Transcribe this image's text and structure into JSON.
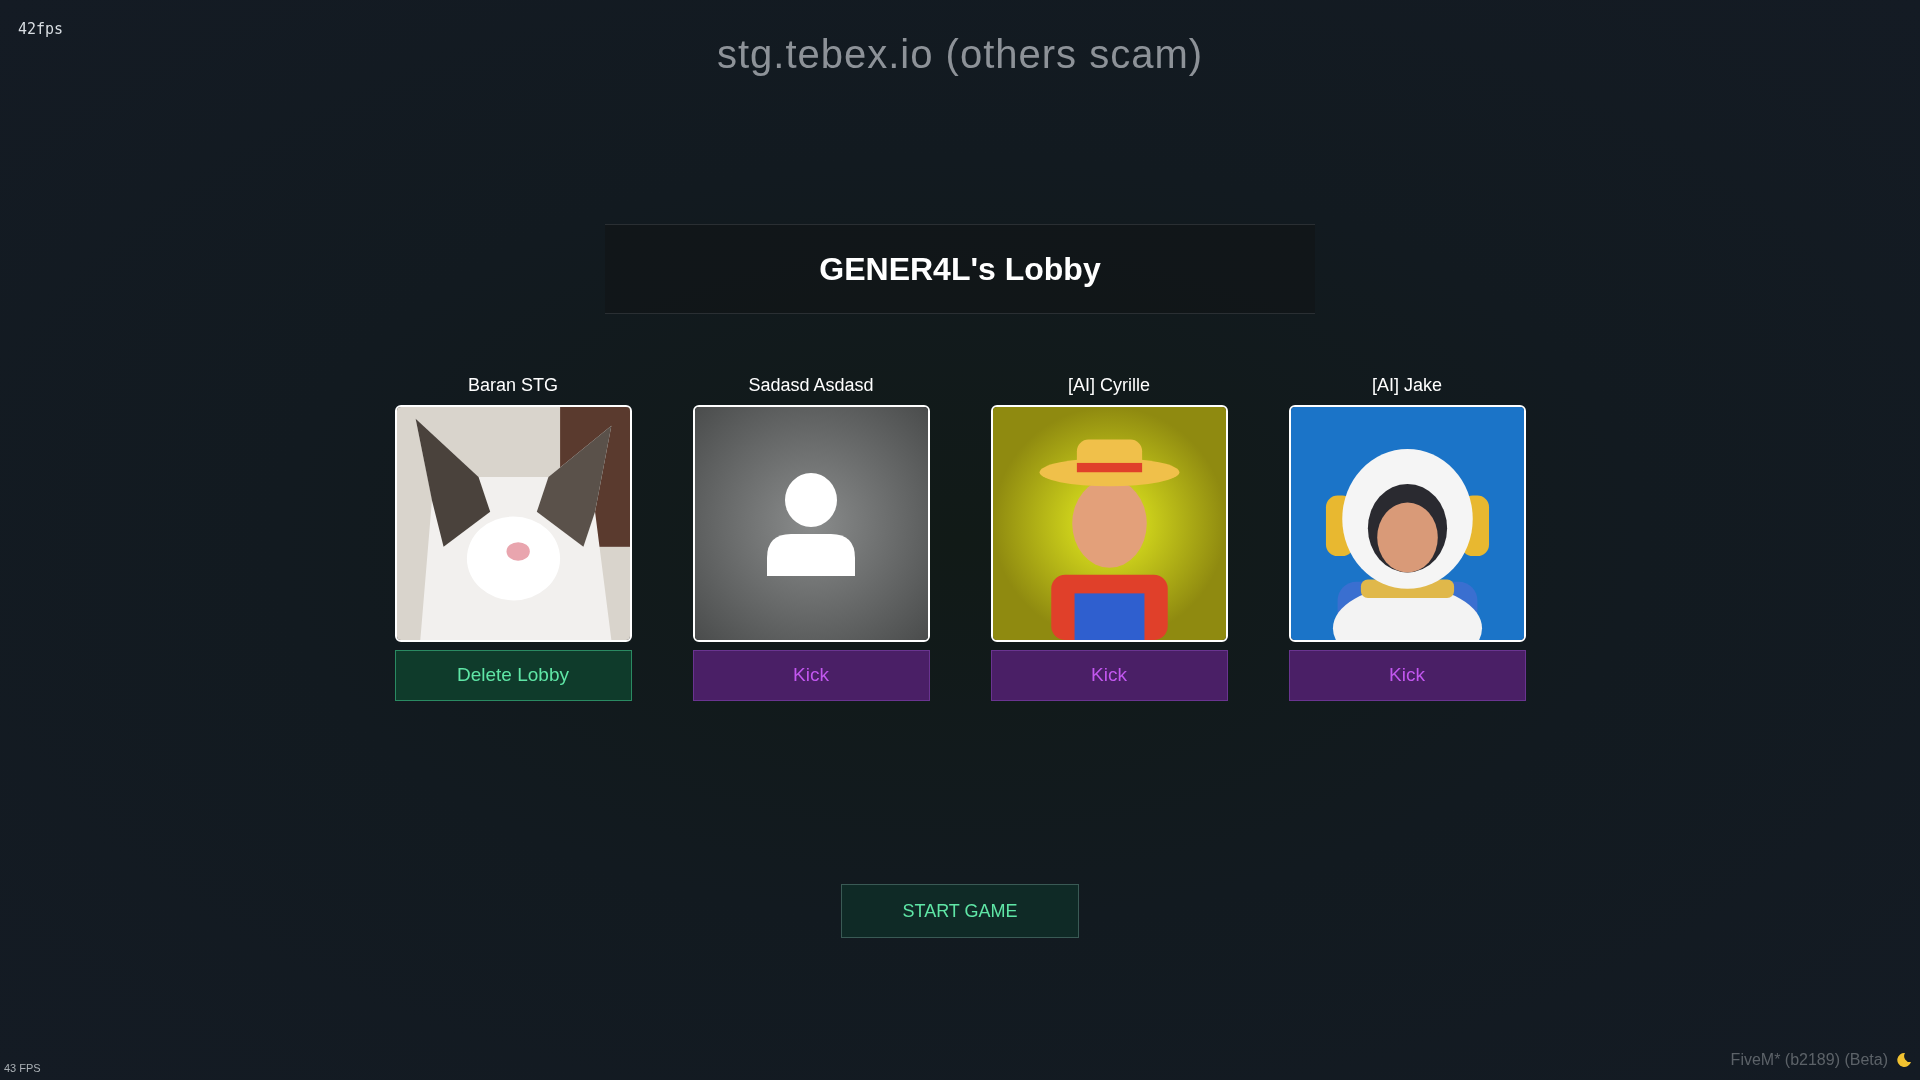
{
  "fps_counter": "42fps",
  "banner": "stg.tebex.io (others scam)",
  "lobby_title": "GENER4L's Lobby",
  "players": [
    {
      "name": "Baran STG",
      "action": {
        "kind": "delete",
        "label": "Delete Lobby"
      }
    },
    {
      "name": "Sadasd Asdasd",
      "avatar": {
        "kind": "placeholder"
      },
      "action": {
        "kind": "kick",
        "label": "Kick"
      }
    },
    {
      "name": "[AI] Cyrille",
      "action": {
        "kind": "kick",
        "label": "Kick"
      }
    },
    {
      "name": "[AI] Jake",
      "action": {
        "kind": "kick",
        "label": "Kick"
      }
    }
  ],
  "start_button": "START GAME",
  "fps_overlay": "43 FPS",
  "version_label": "FiveM* (b2189) (Beta)"
}
